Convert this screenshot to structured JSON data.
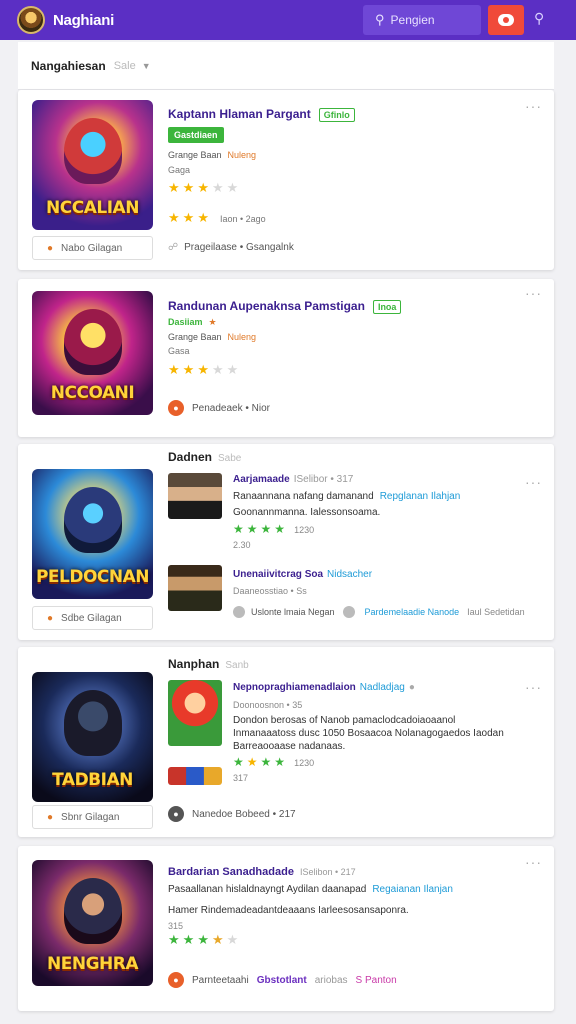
{
  "header": {
    "app_title": "Naghiani",
    "search_placeholder": "Pengien",
    "accent": "#5b2fc4",
    "record_color": "#f04a3a"
  },
  "filter": {
    "label": "Nangahiesan",
    "sort": "Sale"
  },
  "card1": {
    "title": "Kaptann Hlaman Pargant",
    "tag": "Gfinlo",
    "status": "Gastdiaen",
    "meta1": "Grange Baan",
    "meta1_extra": "Nuleng",
    "meta2": "Gaga",
    "rating_count": "Iaon • 2ago",
    "thumb_text": "NCCALIAN",
    "button": "Nabo Gilagan",
    "footer": "Prageilaase • Gsangalnk"
  },
  "card2": {
    "title": "Randunan Aupenaknsa Pamstigan",
    "tag": "Inoa",
    "status": "Dasiiam",
    "meta1": "Grange Baan",
    "meta1_extra": "Nuleng",
    "meta2": "Gasa",
    "thumb_text": "NCCOANI",
    "footer": "Penadeaek • Nior"
  },
  "card3": {
    "section": "Dadnen",
    "section_sub": "Sabe",
    "thumb_text": "PELDOCNAN",
    "button": "Sdbe Gilagan",
    "p1": {
      "title": "Aarjamaade",
      "title_sub": "ISelibor • 317",
      "line1": "Ranaannana nafang damanand",
      "line1_link": "Repglanan Ilahjan",
      "line2": "Goonannmanna. Ialessonsoama.",
      "rating": "1230",
      "sub": "2.30"
    },
    "p2": {
      "title": "Unenaiivitcrag Soa",
      "title_link": "Nidsacher",
      "sub": "Daaneosstiao • Ss",
      "foot1": "Uslonte lmaia Negan",
      "foot2": "Pardemelaadie Nanode",
      "foot3": "Iaul Sedetidan"
    }
  },
  "card4": {
    "section": "Nanphan",
    "section_sub": "Sanb",
    "thumb_text": "TADBIAN",
    "button": "Sbnr Gilagan",
    "p1": {
      "title": "Nepnopraghiamenadlaion",
      "title_link": "Nadladjag",
      "sub": "Doonoosnon • 35",
      "line1": "Dondon berosas of Nanob pamaclodcadoiaoaanol",
      "line2": "Inmanaaatoss dusc 1050 Bosaacoa Nolanagogaedos Iaodan",
      "line3": "Barreaooaase nadanaas.",
      "rating": "1230",
      "sub2": "317"
    },
    "footer": "Nanedoe Bobeed • 217"
  },
  "card5": {
    "title": "Bardarian Sanadhadade",
    "title_sub": "ISelibon • 217",
    "line1": "Pasaallanan hislaldnayngt Aydilan daanapad",
    "line1_link": "Regaianan Ilanjan",
    "line2": "Hamer Rindemadeadantdeaaans Iarleesosansaponra.",
    "sub": "315",
    "thumb_text": "NENGHRA",
    "footer_a": "Parnteetaahi",
    "footer_b": "Gbstotlant",
    "footer_c": "ariobas",
    "footer_d": "S Panton"
  }
}
